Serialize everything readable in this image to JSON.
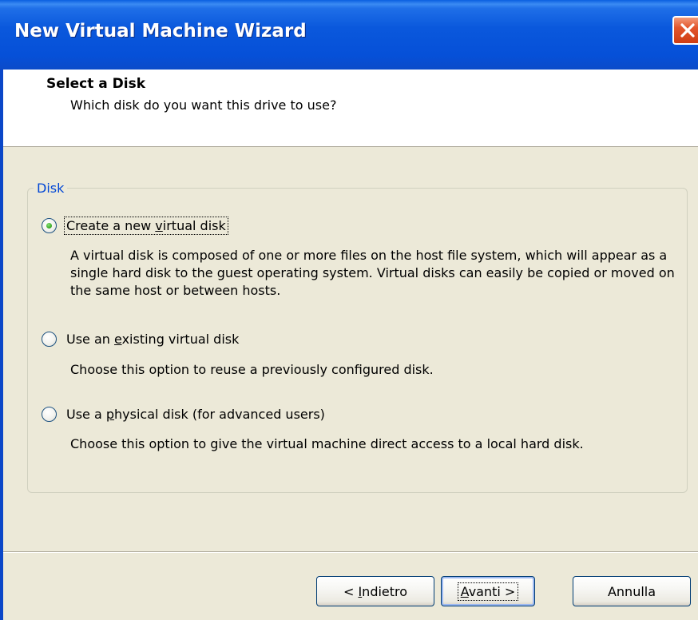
{
  "window": {
    "title": "New Virtual Machine Wizard"
  },
  "header": {
    "title": "Select a Disk",
    "subtitle": "Which disk do you want this drive to use?"
  },
  "group": {
    "label": "Disk"
  },
  "options": [
    {
      "label_pre": "Create a new ",
      "label_key": "v",
      "label_post": "irtual disk",
      "checked": true,
      "description": "A virtual disk is composed of one or more files on the host file system, which will appear as a single hard disk to the guest operating system. Virtual disks can easily be copied or moved on the same host or between hosts."
    },
    {
      "label_pre": "Use an ",
      "label_key": "e",
      "label_post": "xisting virtual disk",
      "checked": false,
      "description": "Choose this option to reuse a previously configured disk."
    },
    {
      "label_pre": "Use a ",
      "label_key": "p",
      "label_post": "hysical disk (for advanced users)",
      "checked": false,
      "description": "Choose this option to give the virtual machine direct access to a local hard disk."
    }
  ],
  "buttons": {
    "back_pre": "< ",
    "back_key": "I",
    "back_post": "ndietro",
    "next_key": "A",
    "next_post": "vanti >",
    "cancel": "Annulla"
  },
  "colors": {
    "titlebar": "#0a58dc",
    "legend": "#0046d5",
    "dialog_bg": "#ece9d8"
  }
}
